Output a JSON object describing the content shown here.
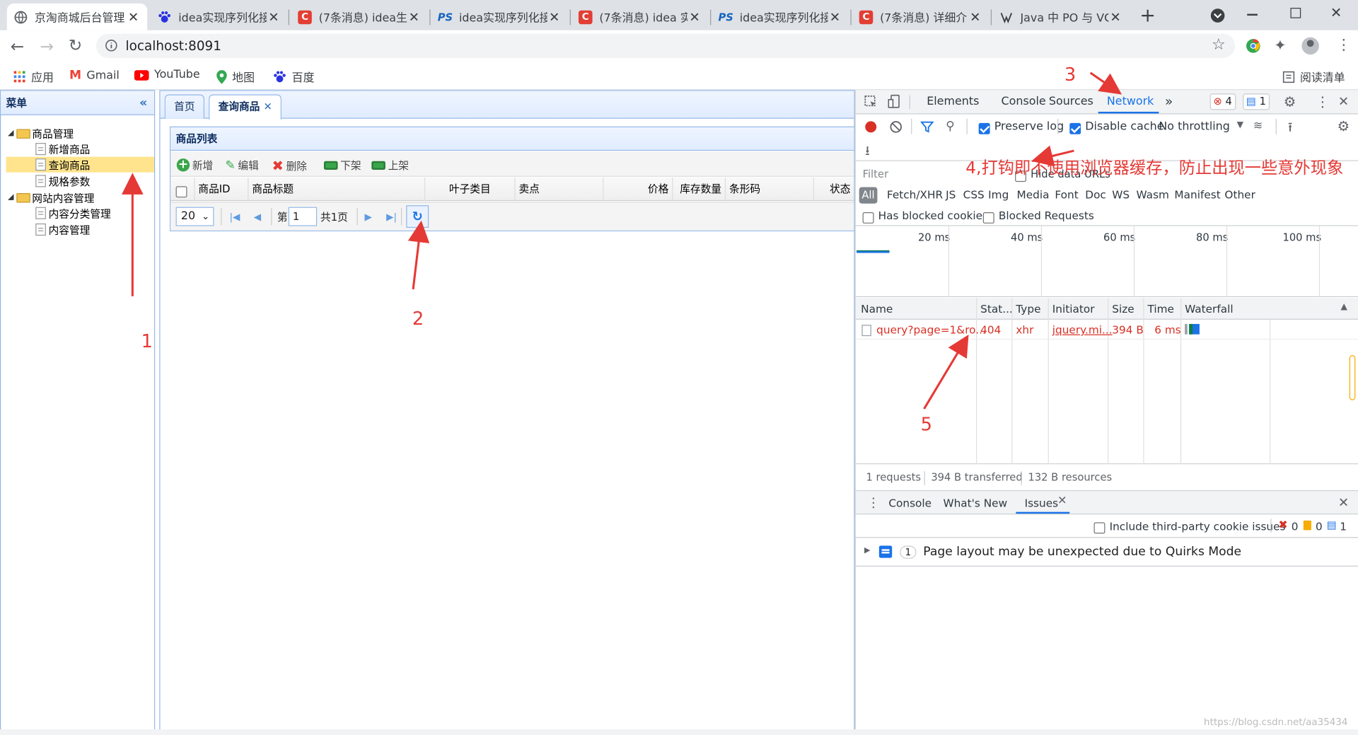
{
  "browser": {
    "tabs": [
      {
        "title": "京淘商城后台管理",
        "fav": "globe",
        "active": true
      },
      {
        "title": "idea实现序列化接",
        "fav": "paw"
      },
      {
        "title": "(7条消息) idea生",
        "fav": "c"
      },
      {
        "title": "idea实现序列化接",
        "fav": "ps"
      },
      {
        "title": "(7条消息) idea 实",
        "fav": "c"
      },
      {
        "title": "idea实现序列化接",
        "fav": "ps"
      },
      {
        "title": "(7条消息) 详细介",
        "fav": "c"
      },
      {
        "title": "Java 中 PO 与 VC",
        "fav": "vv"
      }
    ],
    "url": "localhost:8091",
    "bookmarks": [
      "应用",
      "Gmail",
      "YouTube",
      "地图",
      "百度"
    ],
    "reading_list": "阅读清单"
  },
  "app": {
    "menu_title": "菜单",
    "tree": [
      {
        "label": "商品管理",
        "type": "folder"
      },
      {
        "label": "新增商品",
        "type": "file"
      },
      {
        "label": "查询商品",
        "type": "file",
        "selected": true
      },
      {
        "label": "规格参数",
        "type": "file"
      },
      {
        "label": "网站内容管理",
        "type": "folder"
      },
      {
        "label": "内容分类管理",
        "type": "file"
      },
      {
        "label": "内容管理",
        "type": "file"
      }
    ],
    "tabs": [
      "首页",
      "查询商品"
    ],
    "panel_title": "商品列表",
    "toolbar": [
      "新增",
      "编辑",
      "删除",
      "下架",
      "上架"
    ],
    "columns": [
      "商品ID",
      "商品标题",
      "叶子类目",
      "卖点",
      "价格",
      "库存数量",
      "条形码",
      "状态"
    ],
    "pager": {
      "page_size": "20",
      "page_prefix": "第",
      "page": "1",
      "total": "共1页"
    }
  },
  "devtools": {
    "panels": [
      "Elements",
      "Console",
      "Sources",
      "Network"
    ],
    "more": "»",
    "error_count": "4",
    "msg_count": "1",
    "preserve_log": "Preserve log",
    "disable_cache": "Disable cache",
    "throttling": "No throttling",
    "filter_placeholder": "Filter",
    "hide_data_urls": "Hide data URLs",
    "types": [
      "All",
      "Fetch/XHR",
      "JS",
      "CSS",
      "Img",
      "Media",
      "Font",
      "Doc",
      "WS",
      "Wasm",
      "Manifest",
      "Other"
    ],
    "has_blocked": "Has blocked cookies",
    "blocked_requests": "Blocked Requests",
    "timeline": [
      "20 ms",
      "40 ms",
      "60 ms",
      "80 ms",
      "100 ms"
    ],
    "table_cols": [
      "Name",
      "Stat...",
      "Type",
      "Initiator",
      "Size",
      "Time",
      "Waterfall"
    ],
    "rows": [
      {
        "name": "query?page=1&ro...",
        "status": "404",
        "type": "xhr",
        "initiator": "jquery.mi...",
        "size": "394 B",
        "time": "6 ms"
      }
    ],
    "summary": [
      "1 requests",
      "394 B transferred",
      "132 B resources"
    ],
    "drawer_tabs": [
      "Console",
      "What's New",
      "Issues"
    ],
    "third_party": "Include third-party cookie issues",
    "counts": [
      "0",
      "0",
      "1"
    ],
    "issue_count": "1",
    "issue": "Page layout may be unexpected due to Quirks Mode"
  },
  "annotations": {
    "n1": "1",
    "n2": "2",
    "n3": "3",
    "n4": "4,打钩即不使用浏览器缓存，防止出现一些意外现象",
    "n5": "5"
  },
  "watermark": "https://blog.csdn.net/aa35434",
  "colors": {
    "annotation": "#e53935",
    "accent": "#1a73e8",
    "easyui_border": "#95b8e7",
    "selected": "#ffe48d"
  }
}
